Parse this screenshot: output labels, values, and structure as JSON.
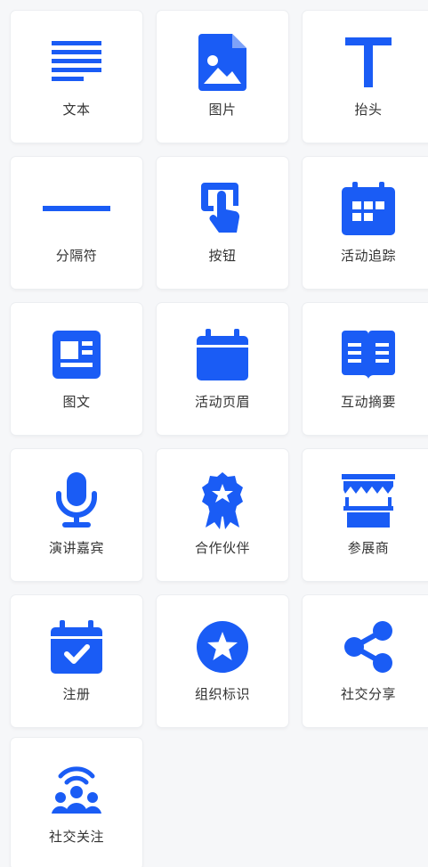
{
  "accent_color": "#1a5cf5",
  "tiles": [
    {
      "label": "文本",
      "icon": "text-icon"
    },
    {
      "label": "图片",
      "icon": "image-icon"
    },
    {
      "label": "抬头",
      "icon": "title-icon"
    },
    {
      "label": "分隔符",
      "icon": "divider-icon"
    },
    {
      "label": "按钮",
      "icon": "button-tap-icon"
    },
    {
      "label": "活动追踪",
      "icon": "calendar-grid-icon"
    },
    {
      "label": "图文",
      "icon": "image-text-icon"
    },
    {
      "label": "活动页眉",
      "icon": "calendar-header-icon"
    },
    {
      "label": "互动摘要",
      "icon": "book-icon"
    },
    {
      "label": "演讲嘉宾",
      "icon": "microphone-icon"
    },
    {
      "label": "合作伙伴",
      "icon": "award-icon"
    },
    {
      "label": "参展商",
      "icon": "booth-icon"
    },
    {
      "label": "注册",
      "icon": "calendar-check-icon"
    },
    {
      "label": "组织标识",
      "icon": "star-badge-icon"
    },
    {
      "label": "社交分享",
      "icon": "share-icon"
    },
    {
      "label": "社交关注",
      "icon": "follow-icon"
    }
  ]
}
